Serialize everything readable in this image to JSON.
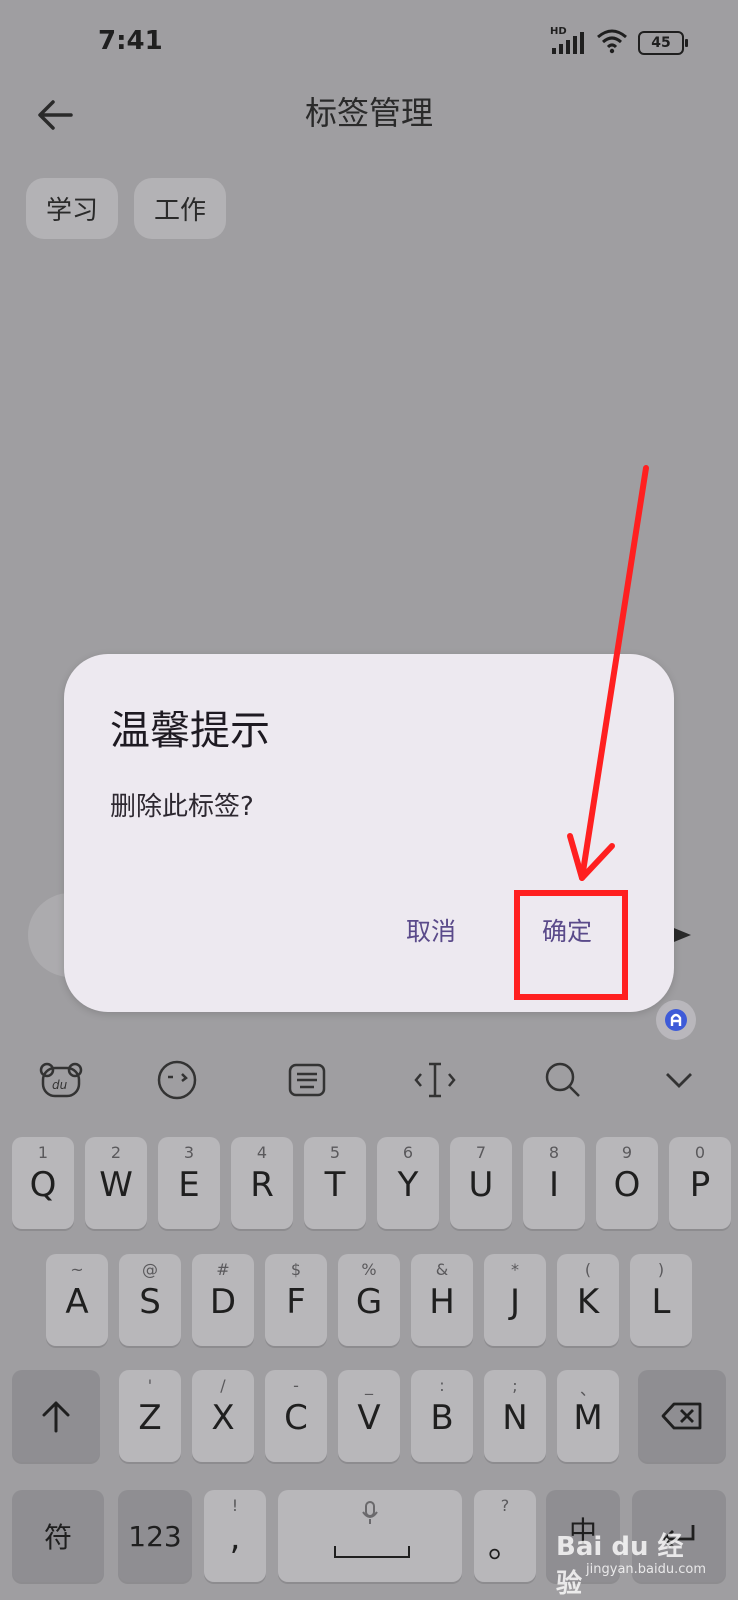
{
  "status": {
    "time": "7:41",
    "network": "HD",
    "battery": "45"
  },
  "header": {
    "title": "标签管理"
  },
  "tags": [
    "学习",
    "工作"
  ],
  "dialog": {
    "title": "温馨提示",
    "message": "删除此标签?",
    "cancel": "取消",
    "confirm": "确定"
  },
  "keyboard": {
    "row1": [
      {
        "hint": "1",
        "key": "Q"
      },
      {
        "hint": "2",
        "key": "W"
      },
      {
        "hint": "3",
        "key": "E"
      },
      {
        "hint": "4",
        "key": "R"
      },
      {
        "hint": "5",
        "key": "T"
      },
      {
        "hint": "6",
        "key": "Y"
      },
      {
        "hint": "7",
        "key": "U"
      },
      {
        "hint": "8",
        "key": "I"
      },
      {
        "hint": "9",
        "key": "O"
      },
      {
        "hint": "0",
        "key": "P"
      }
    ],
    "row2": [
      {
        "hint": "~",
        "key": "A"
      },
      {
        "hint": "@",
        "key": "S"
      },
      {
        "hint": "#",
        "key": "D"
      },
      {
        "hint": "$",
        "key": "F"
      },
      {
        "hint": "%",
        "key": "G"
      },
      {
        "hint": "&",
        "key": "H"
      },
      {
        "hint": "*",
        "key": "J"
      },
      {
        "hint": "(",
        "key": "K"
      },
      {
        "hint": ")",
        "key": "L"
      }
    ],
    "row3": [
      {
        "hint": "'",
        "key": "Z"
      },
      {
        "hint": "/",
        "key": "X"
      },
      {
        "hint": "-",
        "key": "C"
      },
      {
        "hint": "_",
        "key": "V"
      },
      {
        "hint": ":",
        "key": "B"
      },
      {
        "hint": ";",
        "key": "N"
      },
      {
        "hint": "、",
        "key": "M"
      }
    ],
    "symbol_key": "符",
    "num_key": "123",
    "comma_hint": "!",
    "comma_key": ",",
    "period_hint": "?",
    "period_key": "。",
    "lang_key": "中"
  },
  "watermark": {
    "brand": "Bai du 经验",
    "url": "jingyan.baidu.com"
  }
}
